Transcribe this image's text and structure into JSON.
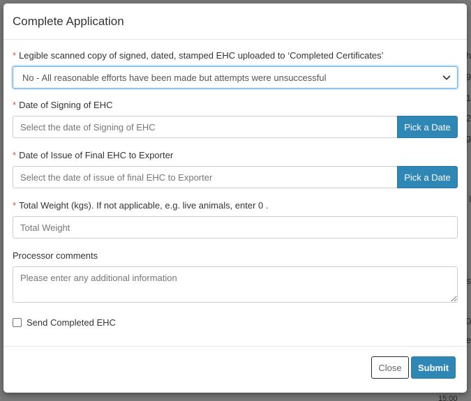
{
  "modal": {
    "title": "Complete Application"
  },
  "form": {
    "legible_copy": {
      "label": "Legible scanned copy of signed, dated, stamped EHC uploaded to ‘Completed Certificates’",
      "selected_value": "No - All reasonable efforts have been made but attempts were unsuccessful"
    },
    "date_signing": {
      "label": "Date of Signing of EHC",
      "placeholder": "Select the date of Signing of EHC",
      "button_label": "Pick a Date"
    },
    "date_issue": {
      "label": "Date of Issue of Final EHC to Exporter",
      "placeholder": "Select the date of issue of final EHC to Exporter",
      "button_label": "Pick a Date"
    },
    "total_weight": {
      "label": "Total Weight (kgs). If not applicable, e.g. live animals, enter 0 .",
      "placeholder": "Total Weight"
    },
    "processor_comments": {
      "label": "Processor comments",
      "placeholder": "Please enter any additional information"
    },
    "send_completed": {
      "label": "Send Completed EHC",
      "checked": false
    },
    "required_marker": "*"
  },
  "footer": {
    "close_label": "Close",
    "submit_label": "Submit"
  },
  "background": {
    "fragments": [
      "h",
      "9",
      "1",
      "2",
      "g",
      "l",
      "s",
      "0",
      "e"
    ],
    "time": "15:00"
  },
  "colors": {
    "primary": "#2f87b6",
    "required": "#d9534f",
    "focus_border": "#66afe9"
  },
  "icons": {
    "select_chevron": "chevron-down-icon"
  }
}
